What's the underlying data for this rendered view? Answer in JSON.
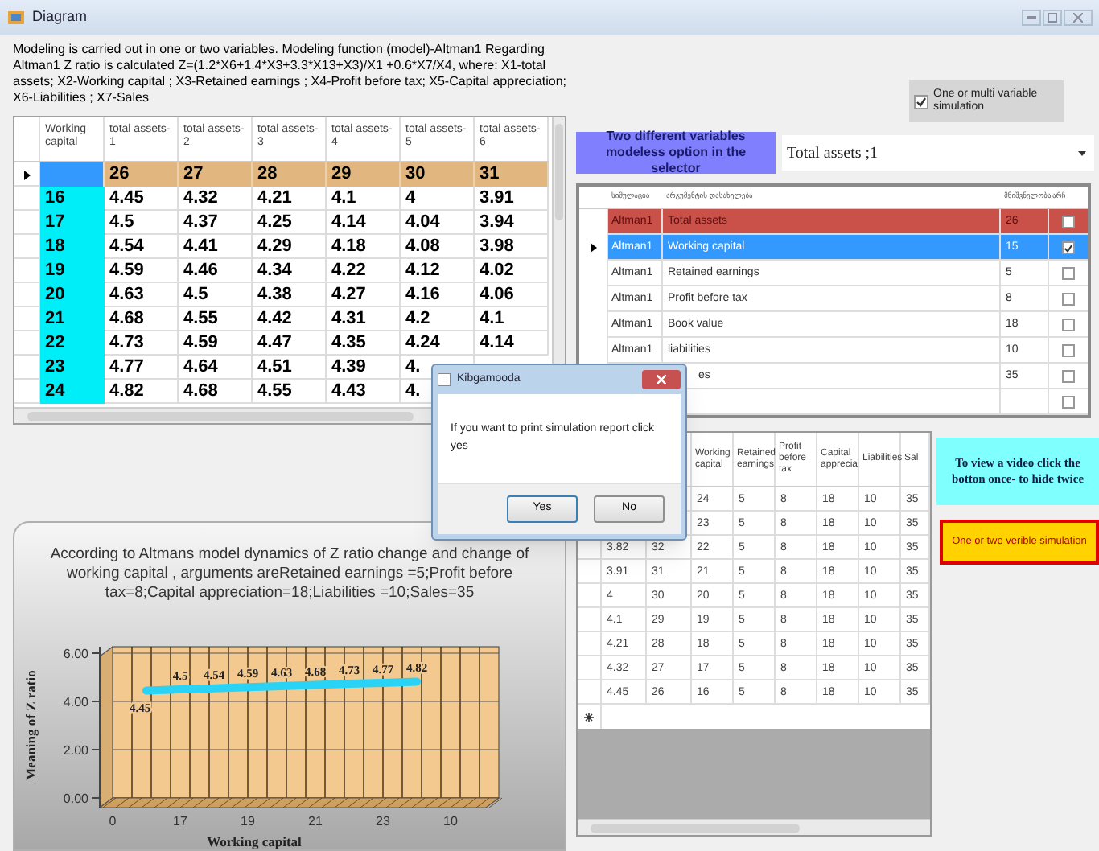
{
  "window": {
    "title": "Diagram"
  },
  "description": "Modeling is carried out in one or two variables. Modeling function (model)-Altman1  Regarding Altman1 Z ratio is calculated Z=(1.2*X6+1.4*X3+3.3*X13+X3)/X1 +0.6*X7/X4, where: X1-total assets; X2-Working capital ; X3-Retained earnings ; X4-Profit before tax; X5-Capital appreciation; X6-Liabilities ; X7-Sales",
  "grid": {
    "columns": [
      "Working capital",
      "total assets-1",
      "total assets-2",
      "total assets-3",
      "total assets-4",
      "total assets-5",
      "total assets-6"
    ],
    "total_row": {
      "current": true,
      "values": [
        "26",
        "27",
        "28",
        "29",
        "30",
        "31"
      ]
    },
    "rows": [
      {
        "working_capital": "16",
        "values": [
          "4.45",
          "4.32",
          "4.21",
          "4.1",
          "4",
          "3.91"
        ]
      },
      {
        "working_capital": "17",
        "values": [
          "4.5",
          "4.37",
          "4.25",
          "4.14",
          "4.04",
          "3.94"
        ]
      },
      {
        "working_capital": "18",
        "values": [
          "4.54",
          "4.41",
          "4.29",
          "4.18",
          "4.08",
          "3.98"
        ]
      },
      {
        "working_capital": "19",
        "values": [
          "4.59",
          "4.46",
          "4.34",
          "4.22",
          "4.12",
          "4.02"
        ]
      },
      {
        "working_capital": "20",
        "values": [
          "4.63",
          "4.5",
          "4.38",
          "4.27",
          "4.16",
          "4.06"
        ]
      },
      {
        "working_capital": "21",
        "values": [
          "4.68",
          "4.55",
          "4.42",
          "4.31",
          "4.2",
          "4.1"
        ]
      },
      {
        "working_capital": "22",
        "values": [
          "4.73",
          "4.59",
          "4.47",
          "4.35",
          "4.24",
          "4.14"
        ]
      },
      {
        "working_capital": "23",
        "values": [
          "4.77",
          "4.64",
          "4.51",
          "4.39",
          "4."
        ]
      },
      {
        "working_capital": "24",
        "values": [
          "4.82",
          "4.68",
          "4.55",
          "4.43",
          "4."
        ]
      }
    ]
  },
  "simulation_toggle": {
    "label": "One or multi variable simulation",
    "checked": true
  },
  "selector_label": "Two different variables modeless option in the selector",
  "selector": {
    "value": "Total assets ;1"
  },
  "arguments_table": {
    "columns": [
      "სიმულაცია",
      "არგუმენტის დასახელება",
      "მნიშვნელობა",
      "არჩ"
    ],
    "rows": [
      {
        "model": "Altman1",
        "argument": "Total assets",
        "value": "26",
        "checked": false,
        "selected": false,
        "flagged": true
      },
      {
        "model": "Altman1",
        "argument": "Working capital",
        "value": "15",
        "checked": true,
        "selected": true,
        "flagged": false
      },
      {
        "model": "Altman1",
        "argument": "Retained earnings",
        "value": "5",
        "checked": false,
        "selected": false,
        "flagged": false
      },
      {
        "model": "Altman1",
        "argument": "Profit before tax",
        "value": "8",
        "checked": false,
        "selected": false,
        "flagged": false
      },
      {
        "model": "Altman1",
        "argument": "Book value",
        "value": "18",
        "checked": false,
        "selected": false,
        "flagged": false
      },
      {
        "model": "Altman1",
        "argument": "liabilities",
        "value": "10",
        "checked": false,
        "selected": false,
        "flagged": false
      },
      {
        "argument": "es",
        "value": "35",
        "checked": false,
        "selected": false,
        "flagged": false
      },
      {
        "checked": false,
        "selected": false,
        "flagged": false
      }
    ]
  },
  "dialog": {
    "title": "Kibgamooda",
    "message": "If you want to print simulation report click yes",
    "buttons": [
      {
        "label": "Yes",
        "selected": true
      },
      {
        "label": "No",
        "selected": false
      }
    ]
  },
  "chart_panel": {
    "chart_data": {
      "type": "line",
      "title": "According to Altmans model dynamics of Z ratio change and change of working capital , arguments areRetained earnings =5;Profit before tax=8;Capital appreciation=18;Liabilities =10;Sales=35",
      "xlabel": "Working capital",
      "ylabel": "Meaning of Z ratio",
      "categories": [
        "0",
        null,
        "17",
        null,
        "19",
        null,
        "21",
        null,
        "23",
        null,
        "10"
      ],
      "yticks": [
        {
          "value": 0,
          "label": "0.00"
        },
        {
          "value": 2,
          "label": "2.00"
        },
        {
          "value": 4,
          "label": "4.00"
        },
        {
          "value": 6,
          "label": "6.00"
        }
      ],
      "ylim": [
        0,
        6
      ],
      "grid": true,
      "data_labels": true,
      "series": [
        {
          "color": "#29d3f5",
          "values": [
            null,
            4.45,
            4.5,
            4.54,
            4.59,
            4.63,
            4.68,
            4.73,
            4.77,
            4.82,
            null
          ]
        }
      ]
    }
  },
  "results_table": {
    "columns": [
      "Working capital",
      "Retained earnings",
      "Profit before tax",
      "Capital apprecia",
      "Liabilities",
      "Sal"
    ],
    "rows": [
      {
        "cells": [
          "24",
          "5",
          "8",
          "18",
          "10",
          "35"
        ]
      },
      {
        "cells": [
          "23",
          "5",
          "8",
          "18",
          "10",
          "35"
        ]
      },
      {
        "cells": [
          "3.82",
          "32",
          "22",
          "5",
          "8",
          "18",
          "10",
          "35"
        ]
      },
      {
        "cells": [
          "3.91",
          "31",
          "21",
          "5",
          "8",
          "18",
          "10",
          "35"
        ]
      },
      {
        "cells": [
          "4",
          "30",
          "20",
          "5",
          "8",
          "18",
          "10",
          "35"
        ]
      },
      {
        "cells": [
          "4.1",
          "29",
          "19",
          "5",
          "8",
          "18",
          "10",
          "35"
        ]
      },
      {
        "cells": [
          "4.21",
          "28",
          "18",
          "5",
          "8",
          "18",
          "10",
          "35"
        ]
      },
      {
        "cells": [
          "4.32",
          "27",
          "17",
          "5",
          "8",
          "18",
          "10",
          "35"
        ]
      },
      {
        "cells": [
          "4.45",
          "26",
          "16",
          "5",
          "8",
          "18",
          "10",
          "35"
        ]
      }
    ]
  },
  "video_hint": "To view a video click the botton once- to hide twice",
  "simulation_button": "One or two verible simulation"
}
